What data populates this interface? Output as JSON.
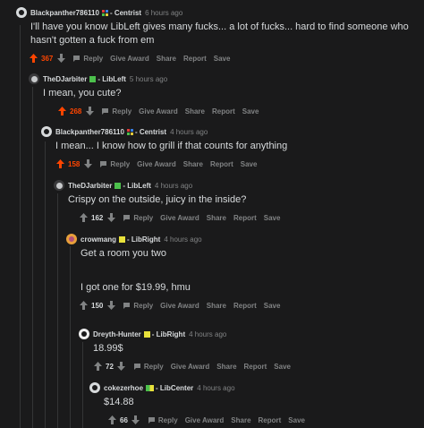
{
  "colors": {
    "background": "#1a1a1b",
    "text": "#d7dadc",
    "muted": "#818384",
    "upvoted": "#ff4500",
    "thread_line": "#343536"
  },
  "action_labels": {
    "reply": "Reply",
    "give_award": "Give Award",
    "share": "Share",
    "report": "Report",
    "save": "Save"
  },
  "comments": [
    {
      "username": "Blackpanther786110",
      "flair": "- Centrist",
      "flair_icon": "centrist-grid",
      "time": "6 hours ago",
      "text": "I'll have you know LibLeft gives many fucks... a lot of fucks... hard to find someone who hasn't gotten a fuck from em",
      "score": "367",
      "upvoted": true
    },
    {
      "username": "TheDJarbiter",
      "flair": "- LibLeft",
      "flair_icon": "libleft-square",
      "time": "5 hours ago",
      "text": "I mean, you cute?",
      "score": "268",
      "upvoted": true
    },
    {
      "username": "Blackpanther786110",
      "flair": "- Centrist",
      "flair_icon": "centrist-grid",
      "time": "4 hours ago",
      "text": "I mean... I know how to grill if that counts for anything",
      "score": "158",
      "upvoted": true
    },
    {
      "username": "TheDJarbiter",
      "flair": "- LibLeft",
      "flair_icon": "libleft-square",
      "time": "4 hours ago",
      "text": "Crispy on the outside, juicy in the inside?",
      "score": "162",
      "upvoted": false
    },
    {
      "username": "crowmang",
      "flair": "- LibRight",
      "flair_icon": "libright-square",
      "time": "4 hours ago",
      "text": "Get a room you two",
      "text2": "I got one for $19.99, hmu",
      "score": "150",
      "upvoted": false
    },
    {
      "username": "Dreyth-Hunter",
      "flair": "- LibRight",
      "flair_icon": "libright-square",
      "time": "4 hours ago",
      "text": "18.99$",
      "score": "72",
      "upvoted": false
    },
    {
      "username": "cokezerhoe",
      "flair": "- LibCenter",
      "flair_icon": "libcenter-bar",
      "time": "4 hours ago",
      "text": "$14.88",
      "score": "66",
      "upvoted": false
    }
  ]
}
